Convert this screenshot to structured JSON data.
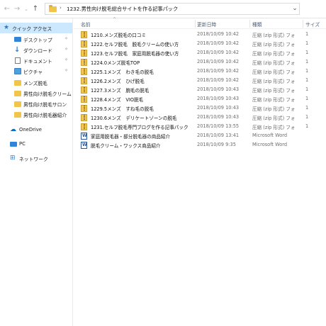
{
  "address": {
    "path": "1232.男性向け脱毛総合サイトを作る記事パック"
  },
  "nav": {
    "back": "←",
    "forward": "→",
    "up_chevron": "⌄",
    "up": "↑",
    "separator": "›",
    "refresh_chevron": "⌄"
  },
  "sidebar": {
    "items": [
      {
        "label": "クイック アクセス",
        "icon": "star-icon"
      },
      {
        "label": "デスクトップ",
        "icon": "desktop-icon"
      },
      {
        "label": "ダウンロード",
        "icon": "download-icon"
      },
      {
        "label": "ドキュメント",
        "icon": "document-icon"
      },
      {
        "label": "ピクチャ",
        "icon": "pictures-icon"
      },
      {
        "label": "メンズ脱毛",
        "icon": "folder-icon"
      },
      {
        "label": "男性向け脱毛クリーム",
        "icon": "folder-icon"
      },
      {
        "label": "男性向け脱毛サロン",
        "icon": "folder-icon"
      },
      {
        "label": "男性向け脱毛器紹介",
        "icon": "folder-icon"
      },
      {
        "label": "OneDrive",
        "icon": "onedrive-icon"
      },
      {
        "label": "PC",
        "icon": "pc-icon"
      },
      {
        "label": "ネットワーク",
        "icon": "network-icon"
      }
    ],
    "pin_glyph": "✧"
  },
  "columns": {
    "name": "名前",
    "date": "更新日時",
    "type": "種類",
    "size": "サイズ"
  },
  "files": [
    {
      "name": "1210.メンズ脱毛の口コミ",
      "date": "2018/10/09 10:42",
      "type": "圧縮 (zip 形式) フォ",
      "size": "1",
      "kind": "zip"
    },
    {
      "name": "1222.セルフ脱毛　脱毛クリームの使い方",
      "date": "2018/10/09 10:42",
      "type": "圧縮 (zip 形式) フォ",
      "size": "1",
      "kind": "zip"
    },
    {
      "name": "1223.セルフ脱毛　家庭用脱毛器の使い方",
      "date": "2018/10/09 10:42",
      "type": "圧縮 (zip 形式) フォ",
      "size": "1",
      "kind": "zip"
    },
    {
      "name": "1224.0メンズ脱毛TOP",
      "date": "2018/10/09 10:42",
      "type": "圧縮 (zip 形式) フォ",
      "size": "1",
      "kind": "zip"
    },
    {
      "name": "1225.1メンズ　わき毛の脱毛",
      "date": "2018/10/09 10:42",
      "type": "圧縮 (zip 形式) フォ",
      "size": "1",
      "kind": "zip"
    },
    {
      "name": "1226.2メンズ　ひげ脱毛",
      "date": "2018/10/09 10:42",
      "type": "圧縮 (zip 形式) フォ",
      "size": "1",
      "kind": "zip"
    },
    {
      "name": "1227.3メンズ　腕毛の脱毛",
      "date": "2018/10/09 10:43",
      "type": "圧縮 (zip 形式) フォ",
      "size": "1",
      "kind": "zip"
    },
    {
      "name": "1228.4メンズ　VIO脱毛",
      "date": "2018/10/09 10:43",
      "type": "圧縮 (zip 形式) フォ",
      "size": "1",
      "kind": "zip"
    },
    {
      "name": "1229.5メンズ　すね毛の脱毛",
      "date": "2018/10/09 10:43",
      "type": "圧縮 (zip 形式) フォ",
      "size": "1",
      "kind": "zip"
    },
    {
      "name": "1230.6メンズ　デリケートゾーンの脱毛",
      "date": "2018/10/09 10:43",
      "type": "圧縮 (zip 形式) フォ",
      "size": "1",
      "kind": "zip"
    },
    {
      "name": "1231.セルフ脱毛専門ブログを作る記事パック",
      "date": "2018/10/09 13:55",
      "type": "圧縮 (zip 形式) フォ",
      "size": "1",
      "kind": "zip"
    },
    {
      "name": "家庭用脱毛器・部分脱毛器の商品紹介",
      "date": "2018/10/09 13:41",
      "type": "Microsoft Word",
      "size": "",
      "kind": "word"
    },
    {
      "name": "脱毛クリーム・ワックス商品紹介",
      "date": "2018/10/09 9:35",
      "type": "Microsoft Word",
      "size": "",
      "kind": "word"
    }
  ],
  "colors": {
    "selection": "#cce8ff",
    "folder": "#f0c54a",
    "accent": "#2b79d4"
  }
}
